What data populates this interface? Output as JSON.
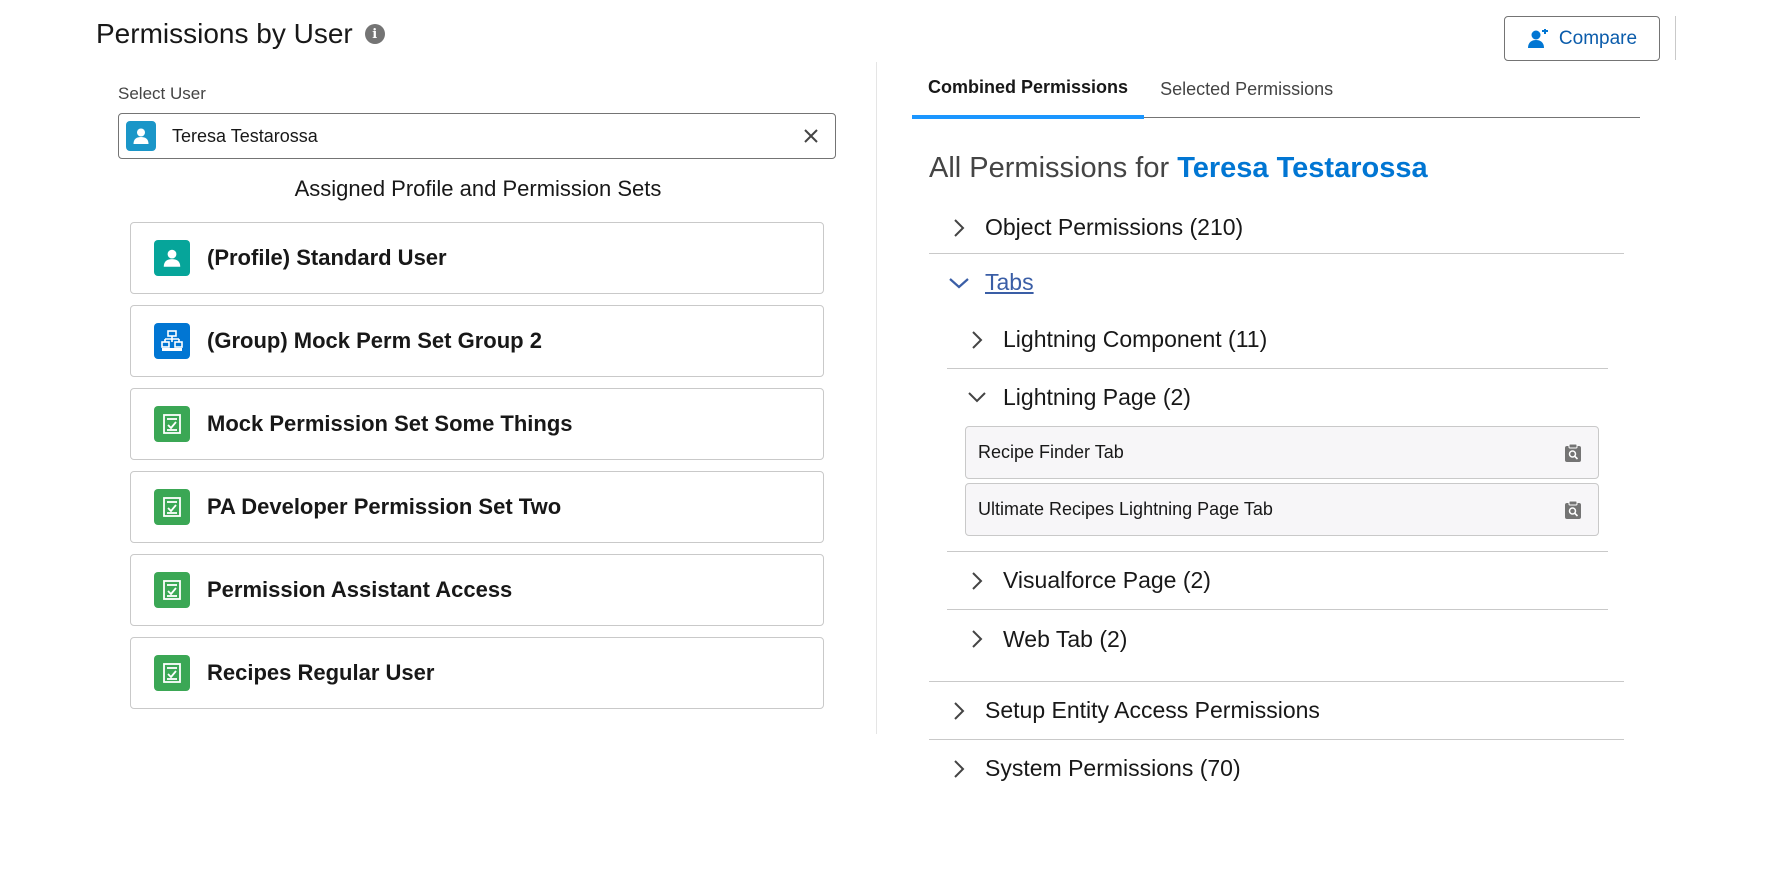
{
  "header": {
    "title": "Permissions by User",
    "compare_label": "Compare"
  },
  "select_user": {
    "label": "Select User",
    "value": "Teresa Testarossa"
  },
  "assigned": {
    "heading": "Assigned Profile and Permission Sets",
    "items": [
      {
        "label": "(Profile) Standard User",
        "icon": "user-icon",
        "color": "#06a59a"
      },
      {
        "label": "(Group) Mock Perm Set Group 2",
        "icon": "hierarchy-icon",
        "color": "#0176d3"
      },
      {
        "label": "Mock Permission Set Some Things",
        "icon": "permission-set-icon",
        "color": "#3ba755"
      },
      {
        "label": "PA Developer Permission Set Two",
        "icon": "permission-set-icon",
        "color": "#3ba755"
      },
      {
        "label": "Permission Assistant Access",
        "icon": "permission-set-icon",
        "color": "#3ba755"
      },
      {
        "label": "Recipes Regular User",
        "icon": "permission-set-icon",
        "color": "#3ba755"
      }
    ]
  },
  "tabs": [
    {
      "label": "Combined Permissions",
      "active": true
    },
    {
      "label": "Selected Permissions",
      "active": false
    }
  ],
  "all_permissions": {
    "prefix": "All Permissions for",
    "user": "Teresa Testarossa"
  },
  "tree": {
    "object_permissions": "Object Permissions (210)",
    "tabs": "Tabs",
    "lightning_component": "Lightning Component (11)",
    "lightning_page": "Lightning Page (2)",
    "lightning_page_items": [
      "Recipe Finder Tab",
      "Ultimate Recipes Lightning Page Tab"
    ],
    "visualforce_page": "Visualforce Page (2)",
    "web_tab": "Web Tab (2)",
    "setup_entity": "Setup Entity Access Permissions",
    "system_permissions": "System Permissions (70)"
  },
  "colors": {
    "brand_blue": "#0176d3",
    "tab_active": "#1b96ff",
    "link": "#3a5ea6"
  }
}
